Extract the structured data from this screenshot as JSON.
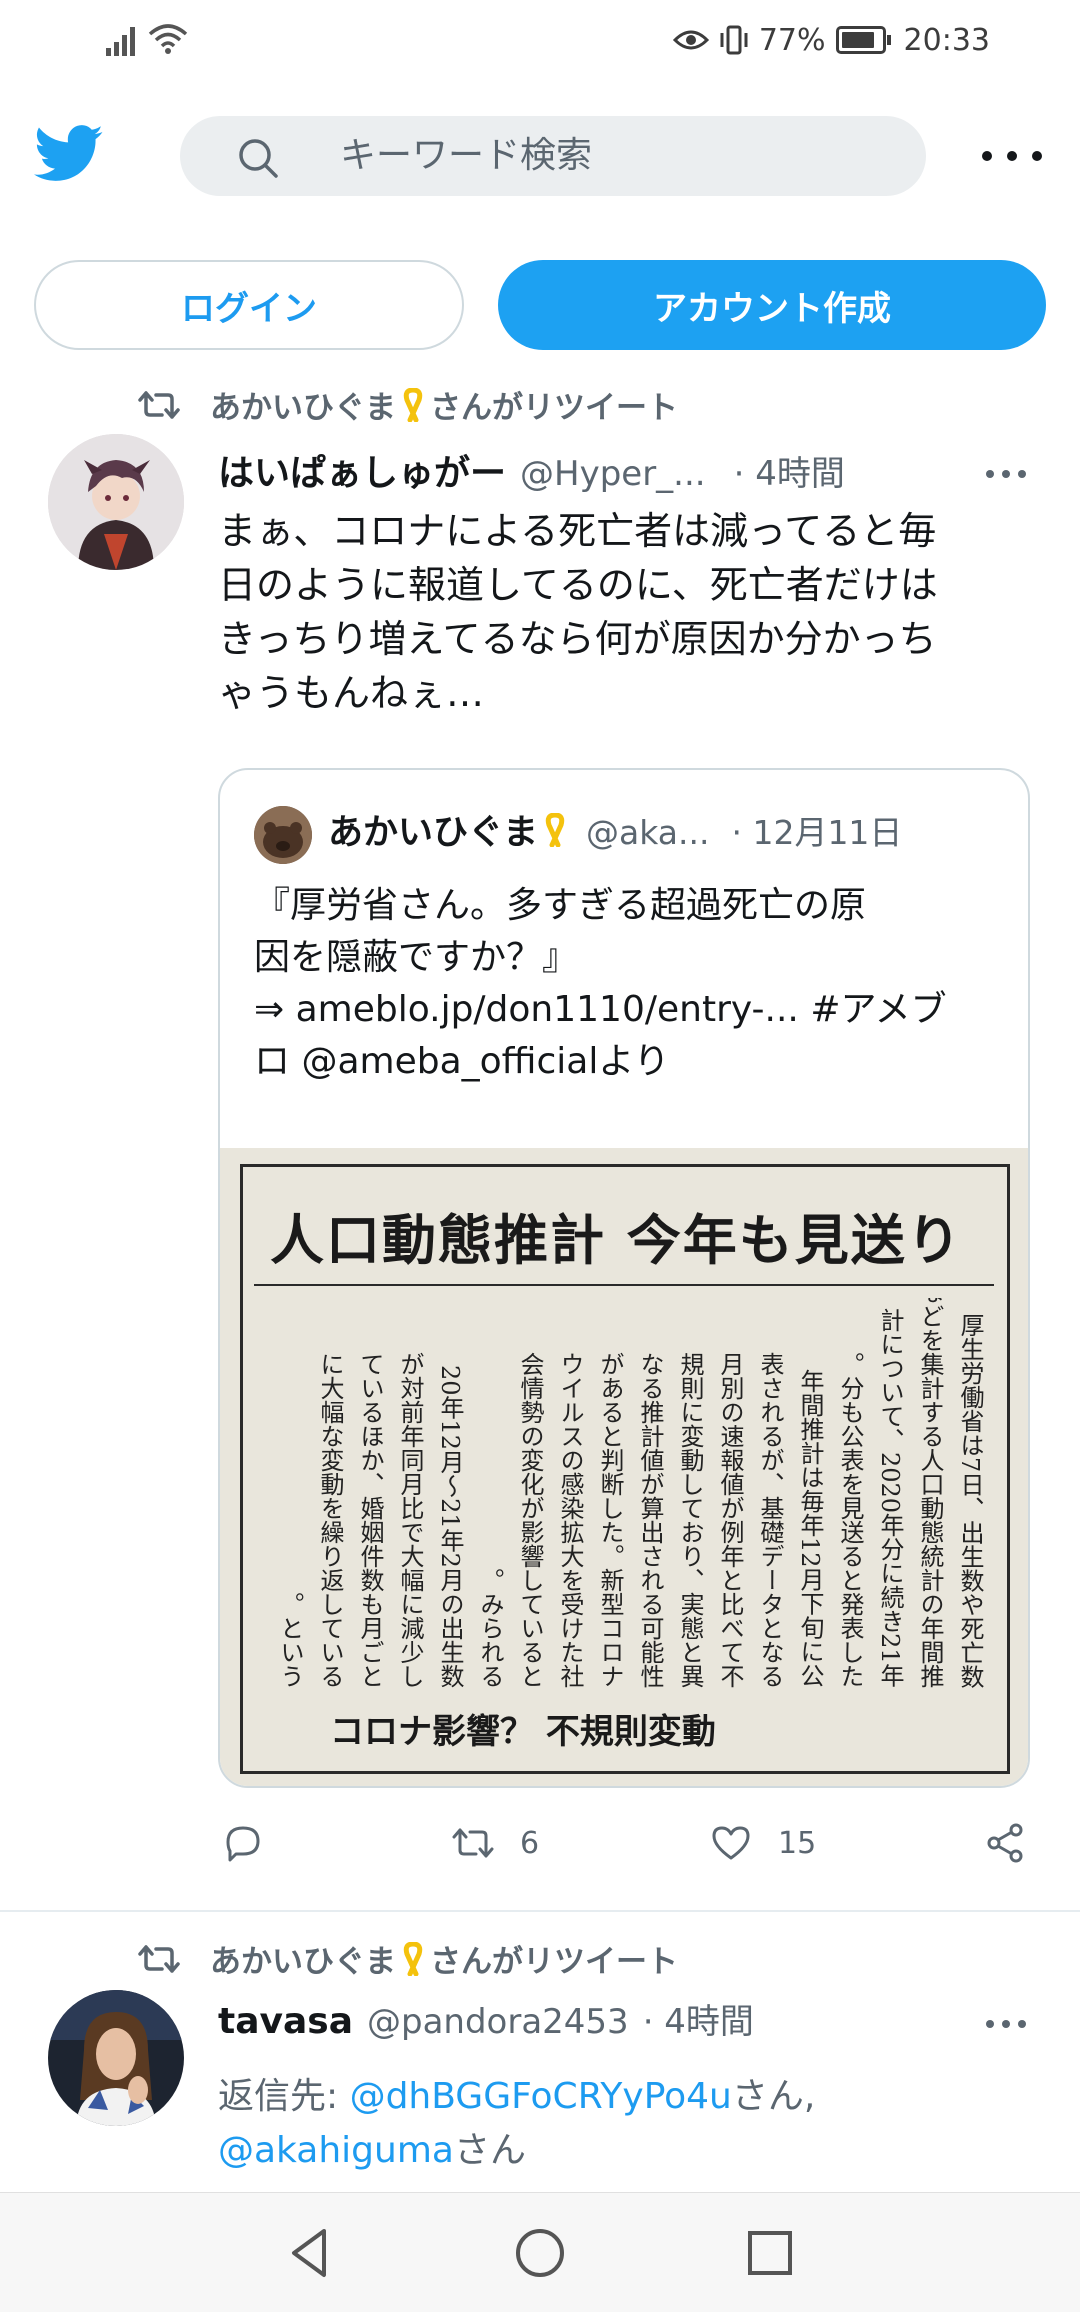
{
  "status_bar": {
    "battery_percent": "77%",
    "time": "20:33",
    "icons": [
      "signal-icon",
      "wifi-icon",
      "eye-icon",
      "vibrate-icon",
      "battery-icon"
    ]
  },
  "header": {
    "search_placeholder": "キーワード検索",
    "icons": [
      "twitter-bird-icon",
      "search-icon",
      "more-icon"
    ]
  },
  "auth": {
    "login_label": "ログイン",
    "signup_label": "アカウント作成"
  },
  "tweet1": {
    "retweeted_by": "あかいひぐま",
    "retweeted_suffix": "さんがリツイート",
    "author_name": "はいぱぁしゅがー",
    "author_handle": "@Hyper_...",
    "time": "· 4時間",
    "text_lines": [
      "まぁ、コロナによる死亡者は減ってると毎",
      "日のように報道してるのに、死亡者だけは",
      "きっちり増えてるなら何が原因か分かっち",
      "ゃうもんねぇ…"
    ],
    "quote": {
      "author_name": "あかいひぐま",
      "author_handle": "@aka...",
      "time": "· 12月11日",
      "text_lines": [
        "『厚労省さん。多すぎる超過死亡の原",
        "因を隠蔽ですか？』",
        "⇒ ameblo.jp/don1110/entry-... #アメブ",
        "ロ @ameba_officialより"
      ],
      "image": {
        "headline": "人口動態推計 今年も見送り",
        "footer": "コロナ影響？ 不規則変動",
        "columns": [
          "厚生労働省は7日、出生数や死亡数",
          "などを集計する人口動態統計の年間推",
          "計について、2020年分に続き21年",
          "分も公表を見送ると発表した。",
          "年間推計は毎年12月下旬に公",
          "表されるが、基礎データとなる",
          "月別の速報値が例年と比べて不",
          "規則に変動しており、実態と異",
          "なる推計値が算出される可能性",
          "があると判断した。新型コロナ",
          "ウイルスの感染拡大を受けた社",
          "会情勢の変化が影響していると",
          "みられる。",
          "20年12月～21年2月の出生数",
          "が対前年同月比で大幅に減少し",
          "ているほか、婚姻件数も月ごと",
          "に大幅な変動を繰り返している",
          "という。"
        ]
      }
    },
    "actions": {
      "retweets": "6",
      "likes": "15"
    }
  },
  "tweet2": {
    "retweeted_by": "あかいひぐま",
    "retweeted_suffix": "さんがリツイート",
    "author_name": "tavasa",
    "author_handle": "@pandora2453",
    "time": "· 4時間",
    "reply_prefix": "返信先: ",
    "reply_to_1": "@dhBGGFoCRYyPo4u",
    "reply_san_1": "さん,",
    "reply_to_2": "@akahiguma",
    "reply_san_2": "さん"
  },
  "navbar": {
    "icons": [
      "back-icon",
      "home-icon",
      "recents-icon"
    ]
  }
}
